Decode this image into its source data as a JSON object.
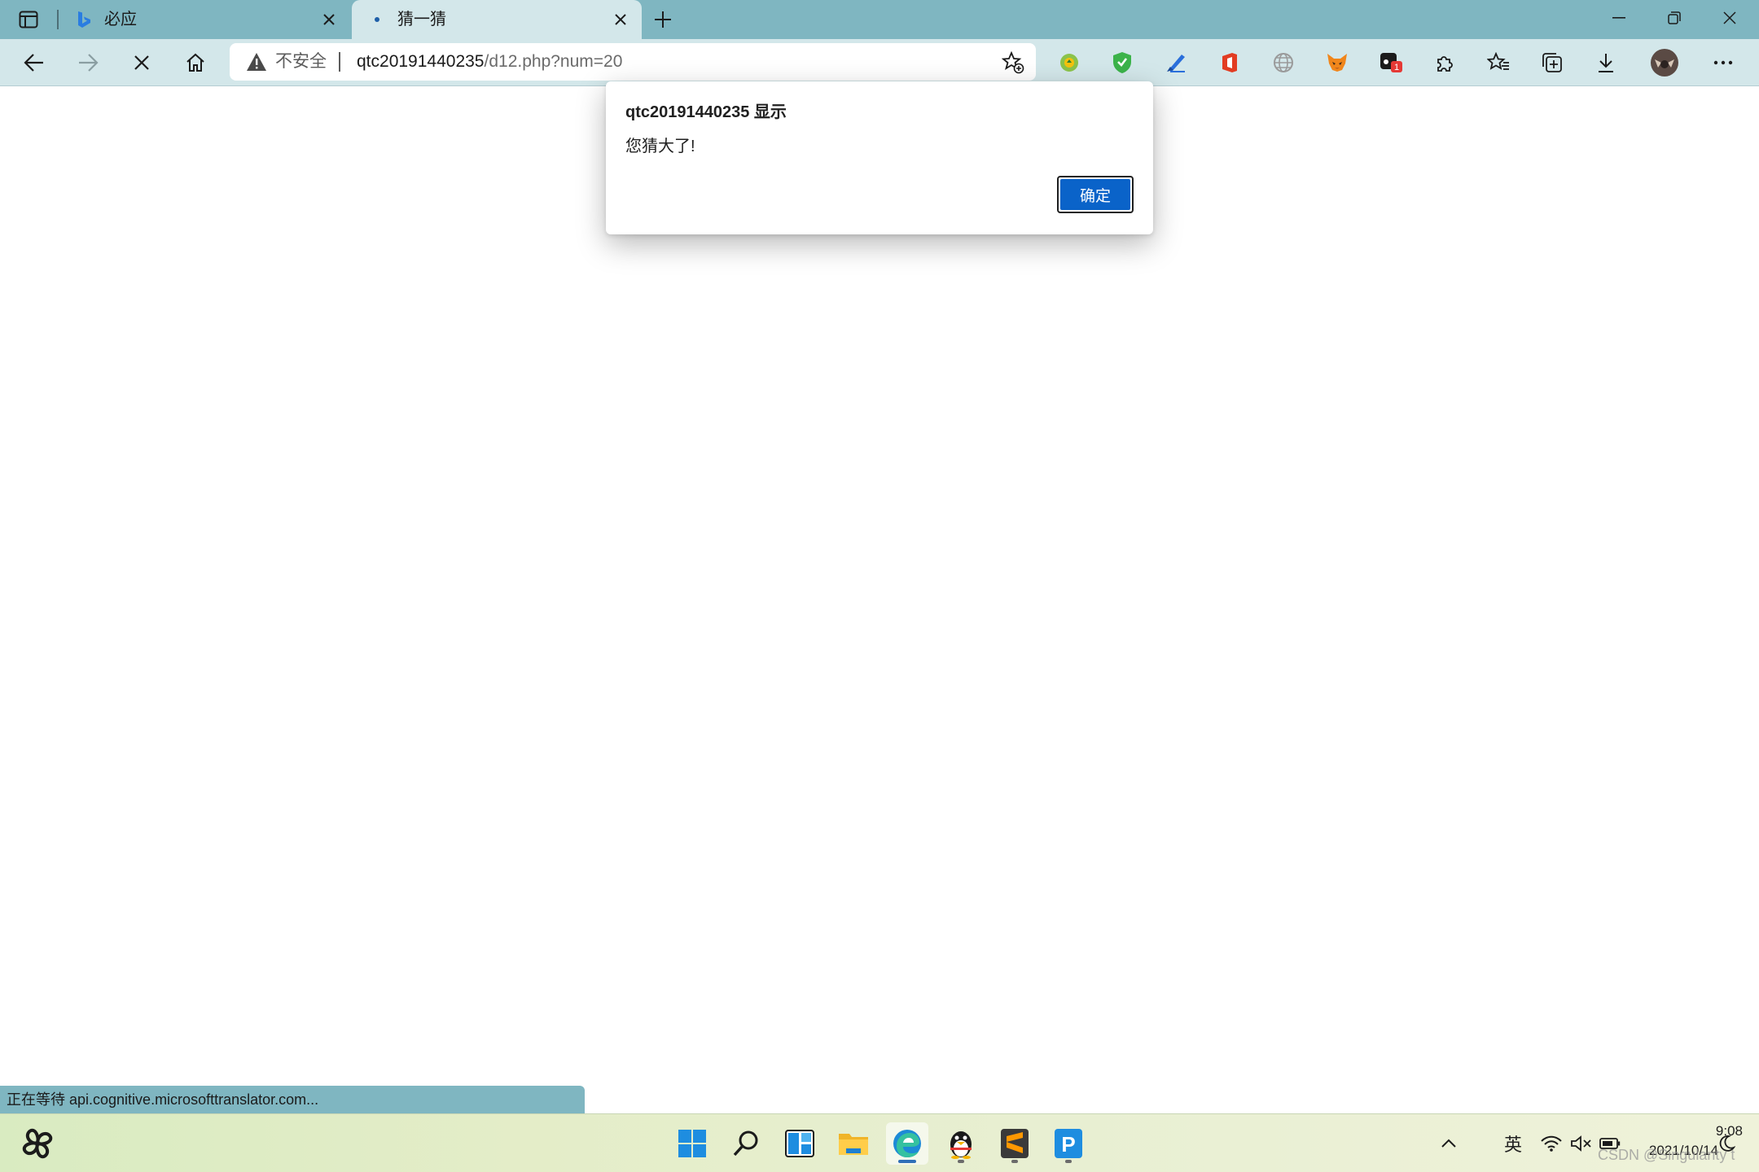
{
  "browser": {
    "tabs": [
      {
        "title": "必应",
        "active": false,
        "favicon": "bing-icon"
      },
      {
        "title": "猜一猜",
        "active": true,
        "favicon": "loading-dot-icon"
      }
    ],
    "address_bar": {
      "security_label": "不安全",
      "url_host": "qtc20191440235",
      "url_path": "/d12.php?num=20"
    },
    "colors": {
      "tabstrip": "#7fb6c1",
      "toolbar": "#d3e7ea",
      "accent": "#0a63c9"
    }
  },
  "dialog": {
    "title": "qtc20191440235 显示",
    "message": "您猜大了!",
    "ok_label": "确定"
  },
  "status_bar": {
    "text": "正在等待 api.cognitive.microsofttranslator.com..."
  },
  "extensions": {
    "badge_count": "1"
  },
  "taskbar": {
    "input_method": "英",
    "time": "9:08",
    "date": "2021/10/14",
    "watermark": "CSDN @Singularity t"
  }
}
